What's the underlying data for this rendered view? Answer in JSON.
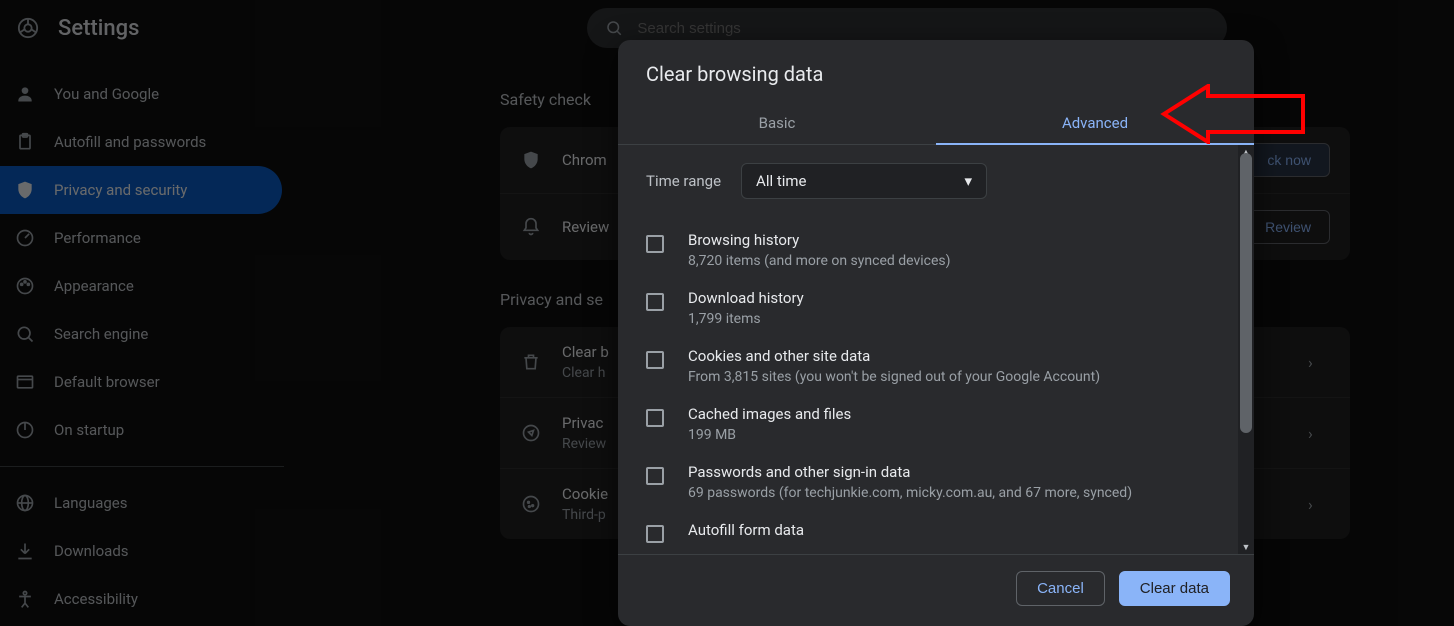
{
  "header": {
    "title": "Settings",
    "search_placeholder": "Search settings"
  },
  "sidebar": {
    "items": [
      {
        "label": "You and Google"
      },
      {
        "label": "Autofill and passwords"
      },
      {
        "label": "Privacy and security"
      },
      {
        "label": "Performance"
      },
      {
        "label": "Appearance"
      },
      {
        "label": "Search engine"
      },
      {
        "label": "Default browser"
      },
      {
        "label": "On startup"
      }
    ],
    "items2": [
      {
        "label": "Languages"
      },
      {
        "label": "Downloads"
      },
      {
        "label": "Accessibility"
      }
    ]
  },
  "main": {
    "safety_section": "Safety check",
    "safety_row1_title": "Chrom",
    "check_now": "ck now",
    "review_title": "Review",
    "review_btn": "Review",
    "privacy_section": "Privacy and se",
    "rows": [
      {
        "title": "Clear b",
        "sub": "Clear h"
      },
      {
        "title": "Privac",
        "sub": "Review"
      },
      {
        "title": "Cookie",
        "sub": "Third-p"
      }
    ]
  },
  "dialog": {
    "title": "Clear browsing data",
    "tab_basic": "Basic",
    "tab_advanced": "Advanced",
    "time_range_label": "Time range",
    "time_range_value": "All time",
    "items": [
      {
        "title": "Browsing history",
        "sub": "8,720 items (and more on synced devices)"
      },
      {
        "title": "Download history",
        "sub": "1,799 items"
      },
      {
        "title": "Cookies and other site data",
        "sub": "From 3,815 sites (you won't be signed out of your Google Account)"
      },
      {
        "title": "Cached images and files",
        "sub": "199 MB"
      },
      {
        "title": "Passwords and other sign-in data",
        "sub": "69 passwords (for techjunkie.com, micky.com.au, and 67 more, synced)"
      },
      {
        "title": "Autofill form data",
        "sub": ""
      }
    ],
    "cancel": "Cancel",
    "clear": "Clear data"
  }
}
